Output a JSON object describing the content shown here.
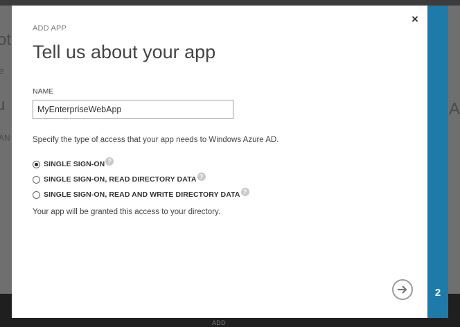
{
  "background": {
    "fragments": [
      "ot",
      "e",
      "u",
      "AN",
      "s A"
    ],
    "bottom_label": "ADD"
  },
  "dialog": {
    "eyebrow": "ADD APP",
    "title": "Tell us about your app",
    "close_label": "×",
    "name_label": "NAME",
    "name_value": "MyEnterpriseWebApp",
    "description": "Specify the type of access that your app needs to Windows Azure AD.",
    "options": [
      {
        "label": "SINGLE SIGN-ON",
        "selected": true
      },
      {
        "label": "SINGLE SIGN-ON, READ DIRECTORY DATA",
        "selected": false
      },
      {
        "label": "SINGLE SIGN-ON, READ AND WRITE DIRECTORY DATA",
        "selected": false
      }
    ],
    "help_glyph": "?",
    "note": "Your app will be granted this access to your directory.",
    "next_icon": "arrow-right-icon"
  },
  "wizard": {
    "step": "2",
    "accent_color": "#1e7aa8"
  }
}
